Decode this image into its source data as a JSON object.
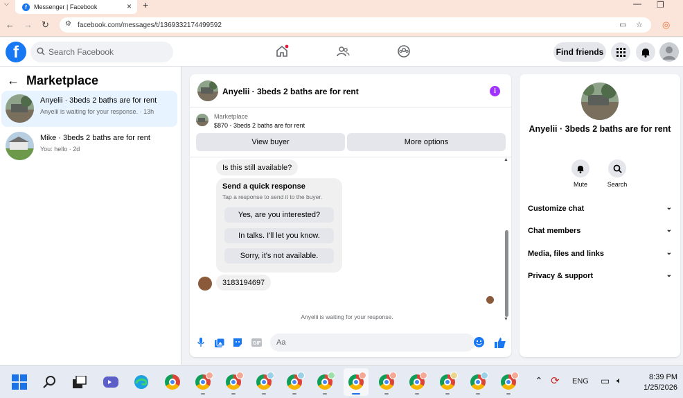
{
  "browser": {
    "tab_title": "Messenger | Facebook",
    "url": "facebook.com/messages/t/1369332174499592"
  },
  "fb": {
    "search_placeholder": "Search Facebook",
    "find_friends": "Find friends"
  },
  "left": {
    "title": "Marketplace",
    "conversations": [
      {
        "name": "Anyelii · 3beds 2 baths are for rent",
        "sub": "Anyelii is waiting for your response. · 13h",
        "active": true
      },
      {
        "name": "Mike · 3beds 2 baths are for rent",
        "sub": "You: hello · 2d",
        "active": false
      }
    ]
  },
  "chat": {
    "title": "Anyelii · 3beds 2 baths are for rent",
    "marketplace_label": "Marketplace",
    "listing": "$870 - 3beds 2 baths are for rent",
    "view_buyer": "View buyer",
    "more_options": "More options",
    "message_question": "Is this still available?",
    "quick_response_title": "Send a quick response",
    "quick_response_sub": "Tap a response to send it to the buyer.",
    "quick_options": [
      "Yes, are you interested?",
      "In talks. I'll let you know.",
      "Sorry, it's not available."
    ],
    "buyer_message": "3183194697",
    "waiting": "Anyelii is waiting for your response.",
    "composer_placeholder": "Aa"
  },
  "right": {
    "name": "Anyelii · 3beds 2 baths are for rent",
    "mute": "Mute",
    "search": "Search",
    "rows": [
      "Customize chat",
      "Chat members",
      "Media, files and links",
      "Privacy & support"
    ]
  },
  "taskbar": {
    "lang": "ENG",
    "time": "8:39 PM",
    "date": "1/25/2026"
  },
  "colors": {
    "accent": "#1877f2",
    "active_row": "#e7f3ff",
    "info_purple": "#a033ff"
  }
}
